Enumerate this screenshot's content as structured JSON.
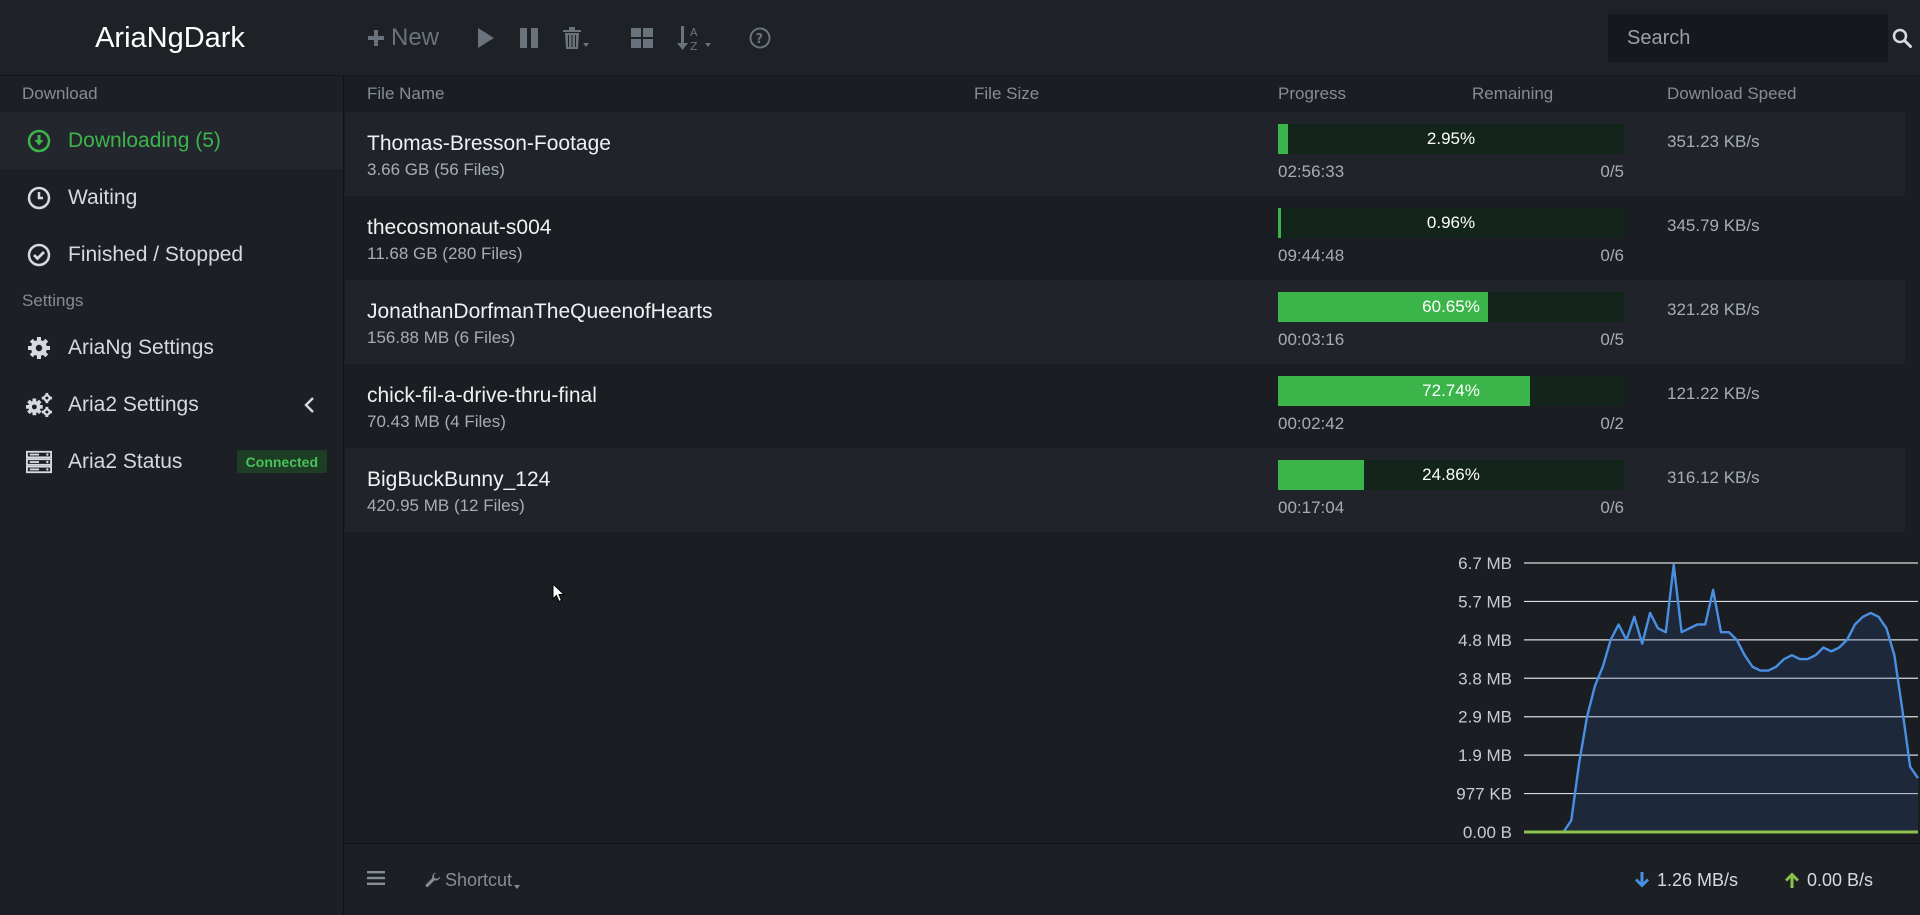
{
  "app": {
    "title": "AriaNgDark"
  },
  "toolbar": {
    "new_label": "New"
  },
  "search": {
    "placeholder": "Search"
  },
  "sidebar": {
    "download_header": "Download",
    "settings_header": "Settings",
    "items": [
      {
        "label": "Downloading (5)",
        "icon": "download-circle-icon",
        "active": true
      },
      {
        "label": "Waiting",
        "icon": "clock-icon"
      },
      {
        "label": "Finished / Stopped",
        "icon": "check-circle-icon"
      },
      {
        "label": "AriaNg Settings",
        "icon": "gear-icon"
      },
      {
        "label": "Aria2 Settings",
        "icon": "gears-icon"
      },
      {
        "label": "Aria2 Status",
        "icon": "server-icon",
        "badge": "Connected"
      }
    ]
  },
  "table": {
    "columns": {
      "name": "File Name",
      "size": "File Size",
      "progress": "Progress",
      "remaining": "Remaining",
      "speed": "Download Speed"
    },
    "rows": [
      {
        "name": "Thomas-Bresson-Footage",
        "size": "3.66 GB (56 Files)",
        "progress": 2.95,
        "progress_label": "2.95%",
        "remaining": "02:56:33",
        "connections": "0/5",
        "speed": "351.23 KB/s"
      },
      {
        "name": "thecosmonaut-s004",
        "size": "11.68 GB (280 Files)",
        "progress": 0.96,
        "progress_label": "0.96%",
        "remaining": "09:44:48",
        "connections": "0/6",
        "speed": "345.79 KB/s"
      },
      {
        "name": "JonathanDorfmanTheQueenofHearts",
        "size": "156.88 MB (6 Files)",
        "progress": 60.65,
        "progress_label": "60.65%",
        "remaining": "00:03:16",
        "connections": "0/5",
        "speed": "321.28 KB/s"
      },
      {
        "name": "chick-fil-a-drive-thru-final",
        "size": "70.43 MB (4 Files)",
        "progress": 72.74,
        "progress_label": "72.74%",
        "remaining": "00:02:42",
        "connections": "0/2",
        "speed": "121.22 KB/s"
      },
      {
        "name": "BigBuckBunny_124",
        "size": "420.95 MB (12 Files)",
        "progress": 24.86,
        "progress_label": "24.86%",
        "remaining": "00:17:04",
        "connections": "0/6",
        "speed": "316.12 KB/s"
      }
    ]
  },
  "chart_data": {
    "type": "area",
    "title": "",
    "xlabel": "",
    "ylabel": "",
    "y_ticks": [
      "0.00 B",
      "977 KB",
      "1.9 MB",
      "2.9 MB",
      "3.8 MB",
      "4.8 MB",
      "5.7 MB",
      "6.7 MB"
    ],
    "ylim": [
      0,
      7
    ],
    "grid": true,
    "series": [
      {
        "color": "#4a90e2",
        "values": [
          0,
          0,
          0,
          0,
          0,
          0,
          0.3,
          1.8,
          3.0,
          3.8,
          4.3,
          5.0,
          5.4,
          5.0,
          5.6,
          4.9,
          5.7,
          5.3,
          5.2,
          6.95,
          5.2,
          5.3,
          5.4,
          5.4,
          6.3,
          5.2,
          5.2,
          5.0,
          4.6,
          4.3,
          4.2,
          4.2,
          4.3,
          4.5,
          4.6,
          4.5,
          4.5,
          4.6,
          4.8,
          4.7,
          4.8,
          5.0,
          5.4,
          5.6,
          5.7,
          5.6,
          5.3,
          4.6,
          3.2,
          1.7,
          1.4
        ]
      },
      {
        "color": "#8bc34a",
        "values": [
          0,
          0,
          0,
          0,
          0,
          0,
          0,
          0,
          0,
          0,
          0,
          0,
          0,
          0,
          0,
          0,
          0,
          0,
          0,
          0,
          0,
          0,
          0,
          0,
          0,
          0,
          0,
          0,
          0,
          0,
          0,
          0,
          0,
          0,
          0,
          0,
          0,
          0,
          0,
          0,
          0,
          0,
          0,
          0,
          0,
          0,
          0,
          0,
          0,
          0,
          0
        ]
      }
    ]
  },
  "footer": {
    "shortcut_label": "Shortcut",
    "download_speed": "1.26 MB/s",
    "upload_speed": "0.00 B/s"
  },
  "colors": {
    "accent": "#3bb54a",
    "chart_line": "#4a90e2",
    "upload": "#8bc34a"
  }
}
